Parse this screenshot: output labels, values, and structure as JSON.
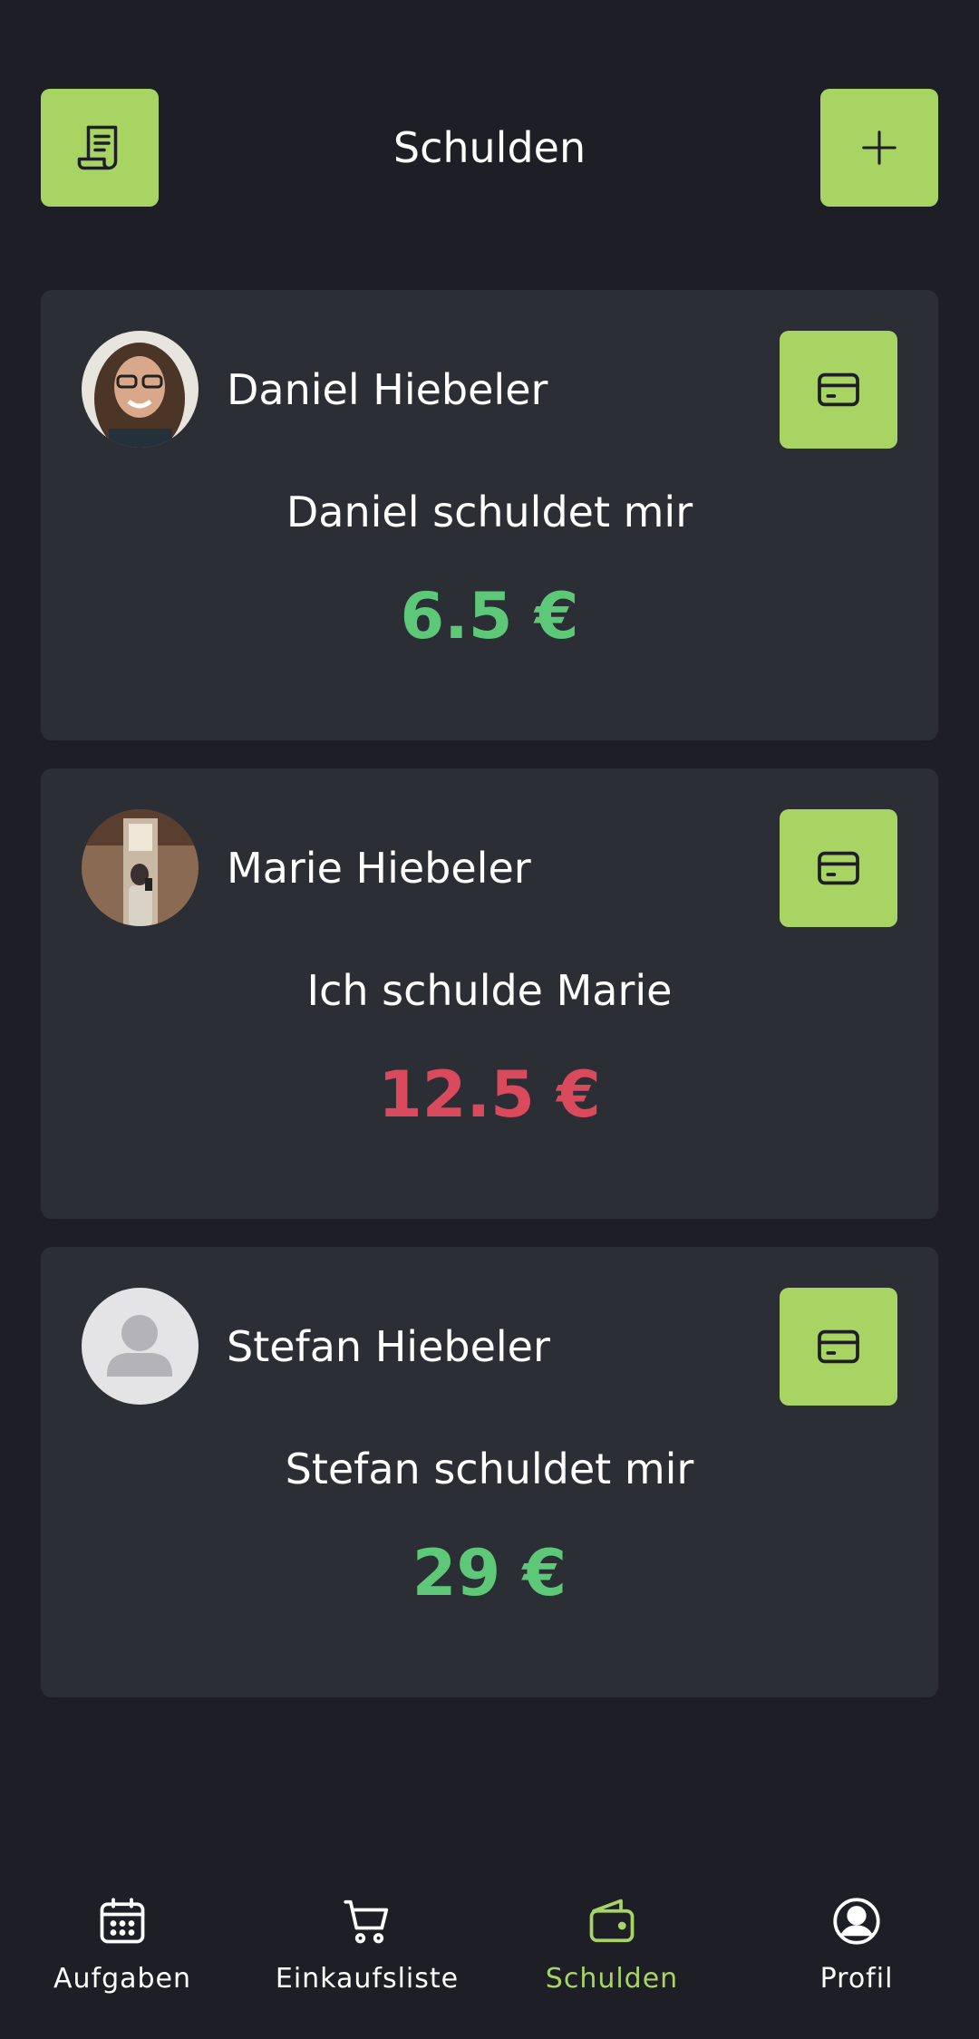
{
  "header": {
    "title": "Schulden",
    "left_icon": "receipt-icon",
    "right_icon": "plus-icon"
  },
  "colors": {
    "accent": "#a8d464",
    "background": "#1e1e26",
    "card": "#2c2e36",
    "positive": "#5cc878",
    "negative": "#d94a5c"
  },
  "debts": [
    {
      "name": "Daniel Hiebeler",
      "label": "Daniel schuldet mir",
      "amount": "6.5 €",
      "status": "positive",
      "avatar": "photo"
    },
    {
      "name": "Marie Hiebeler",
      "label": "Ich schulde Marie",
      "amount": "12.5 €",
      "status": "negative",
      "avatar": "photo"
    },
    {
      "name": "Stefan Hiebeler",
      "label": "Stefan schuldet mir",
      "amount": "29 €",
      "status": "positive",
      "avatar": "placeholder"
    }
  ],
  "nav": {
    "items": [
      {
        "label": "Aufgaben",
        "icon": "calendar-icon",
        "active": false
      },
      {
        "label": "Einkaufsliste",
        "icon": "cart-icon",
        "active": false
      },
      {
        "label": "Schulden",
        "icon": "wallet-icon",
        "active": true
      },
      {
        "label": "Profil",
        "icon": "user-circle-icon",
        "active": false
      }
    ]
  }
}
